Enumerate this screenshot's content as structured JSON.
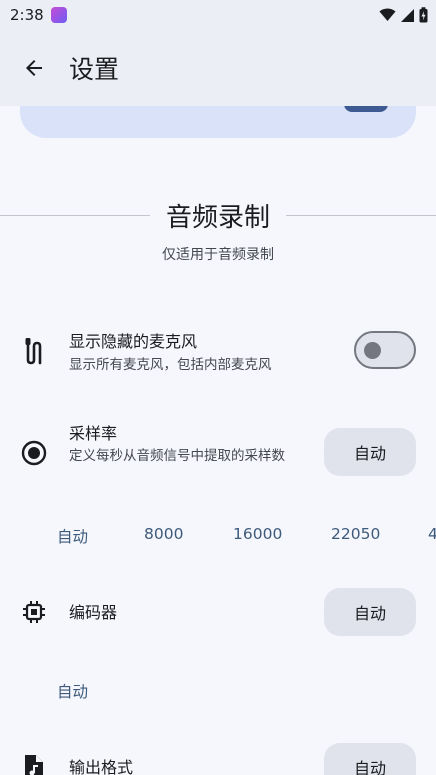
{
  "status_bar": {
    "time": "2:38"
  },
  "app_bar": {
    "title": "设置"
  },
  "section": {
    "title": "音频录制",
    "subtitle": "仅适用于音频录制"
  },
  "settings": {
    "hidden_mics": {
      "title": "显示隐藏的麦克风",
      "description": "显示所有麦克风，包括内部麦克风",
      "enabled": false
    },
    "sample_rate": {
      "title": "采样率",
      "description": "定义每秒从音频信号中提取的采样数",
      "button_label": "自动",
      "options": [
        "自动",
        "8000",
        "16000",
        "22050",
        "4"
      ]
    },
    "encoder": {
      "title": "编码器",
      "button_label": "自动",
      "options": [
        "自动"
      ]
    },
    "output_format": {
      "title": "输出格式",
      "button_label": "自动"
    }
  }
}
